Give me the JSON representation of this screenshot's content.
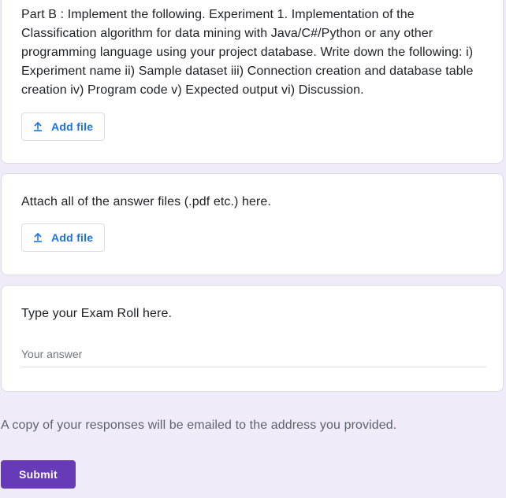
{
  "questions": {
    "part_b": {
      "text": "Part B : Implement the following. Experiment 1. Implementation of the Classification algorithm for data mining with Java/C#/Python or any other programming language using your project database. Write down the following: i) Experiment name ii) Sample dataset iii) Connection creation and database table creation iv) Program code v) Expected output vi) Discussion.",
      "add_file_label": "Add file"
    },
    "attach": {
      "text": "Attach all of the answer files (.pdf etc.) here.",
      "add_file_label": "Add file"
    },
    "exam_roll": {
      "text": "Type your Exam Roll here.",
      "answer_placeholder": "Your answer",
      "answer_value": ""
    }
  },
  "footer": {
    "email_note": "A copy of your responses will be emailed to the address you provided.",
    "submit_label": "Submit"
  },
  "icons": {
    "add_file": "upload-icon"
  },
  "colors": {
    "page_background": "#f0ebf8",
    "accent": "#673ab7",
    "link_blue": "#1a73e8"
  }
}
